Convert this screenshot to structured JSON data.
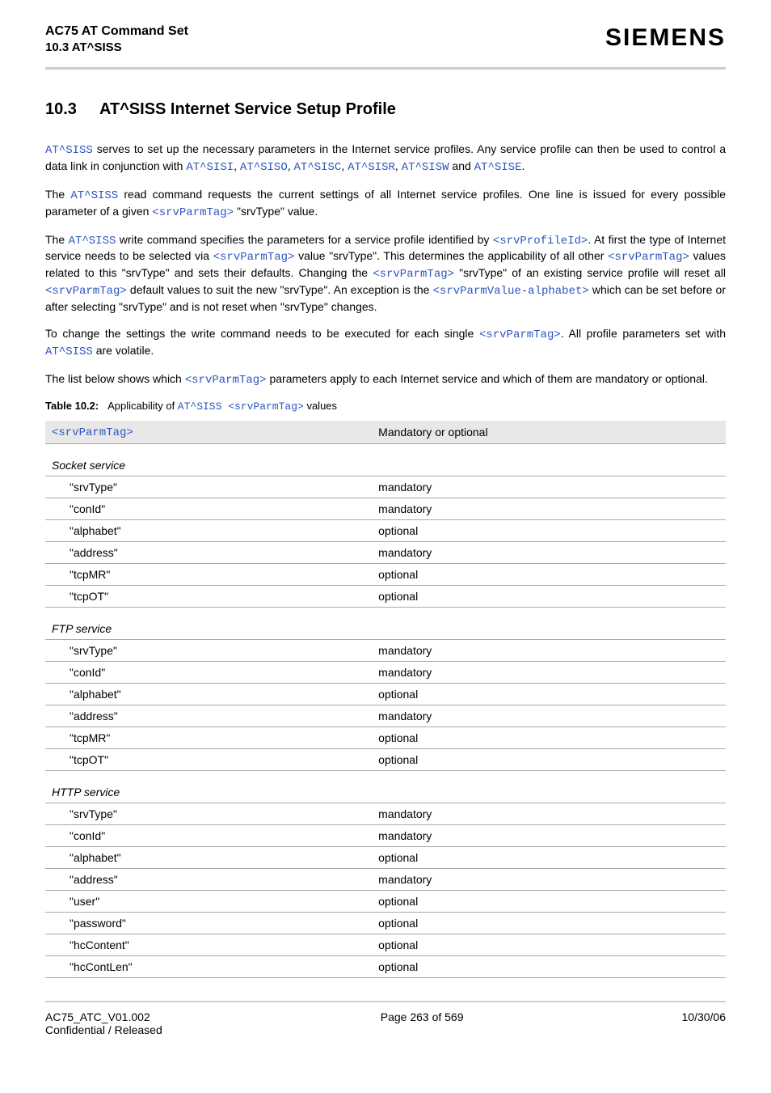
{
  "header": {
    "title": "AC75 AT Command Set",
    "sub": "10.3 AT^SISS",
    "brand": "SIEMENS"
  },
  "section": {
    "num": "10.3",
    "title": "AT^SISS   Internet Service Setup Profile"
  },
  "links": {
    "at_siss": "AT^SISS",
    "at_sisi": "AT^SISI",
    "at_siso": "AT^SISO",
    "at_sisc": "AT^SISC",
    "at_sisr": "AT^SISR",
    "at_sisw": "AT^SISW",
    "at_sise": "AT^SISE",
    "srvParmTag": "<srvParmTag>",
    "srvProfileId": "<srvProfileId>",
    "srvParmValueAlpha": "<srvParmValue-alphabet>"
  },
  "p1a": " serves to set up the necessary parameters in the Internet service profiles. Any service profile can then be used to control a data link in conjunction with ",
  "p1b": ", ",
  "p1c": ", ",
  "p1d": ", ",
  "p1e": ", ",
  "p1f": " and ",
  "p1g": ".",
  "p2a": "The ",
  "p2b": " read command requests the current settings of all Internet service profiles. One line is issued for every possible parameter of a given ",
  "p2c": " \"srvType\" value.",
  "p3a": "The ",
  "p3b": " write command specifies the parameters for a service profile identified by ",
  "p3c": ". At first the type of Internet service needs to be selected via ",
  "p3d": " value \"srvType\". This determines the applicability of all other ",
  "p3e": " values related to this \"srvType\" and sets their defaults. Changing the ",
  "p3f": " \"srvType\" of an existing service profile will reset all ",
  "p3g": " default values to suit the new \"srvType\". An exception is the ",
  "p3h": " which can be set before or after selecting \"srvType\" and is not reset when \"srvType\" changes.",
  "p4a": "To change the settings the write command needs to be executed for each single ",
  "p4b": ". All profile parameters set with ",
  "p4c": " are volatile.",
  "p5a": "The list below shows which ",
  "p5b": " parameters apply to each Internet service and which of them are mandatory or optional.",
  "tableCaption": {
    "label": "Table 10.2:",
    "text1": "Applicability of ",
    "cmd": "AT^SISS ",
    "param": "<srvParmTag>",
    "text2": " values"
  },
  "tableHeaders": {
    "col1": "<srvParmTag>",
    "col2": "Mandatory or optional"
  },
  "services": [
    {
      "name": "Socket service",
      "rows": [
        {
          "tag": "\"srvType\"",
          "opt": "mandatory"
        },
        {
          "tag": "\"conId\"",
          "opt": "mandatory"
        },
        {
          "tag": "\"alphabet\"",
          "opt": "optional"
        },
        {
          "tag": "\"address\"",
          "opt": "mandatory"
        },
        {
          "tag": "\"tcpMR\"",
          "opt": "optional"
        },
        {
          "tag": "\"tcpOT\"",
          "opt": "optional"
        }
      ]
    },
    {
      "name": "FTP service",
      "rows": [
        {
          "tag": "\"srvType\"",
          "opt": "mandatory"
        },
        {
          "tag": "\"conId\"",
          "opt": "mandatory"
        },
        {
          "tag": "\"alphabet\"",
          "opt": "optional"
        },
        {
          "tag": "\"address\"",
          "opt": "mandatory"
        },
        {
          "tag": "\"tcpMR\"",
          "opt": "optional"
        },
        {
          "tag": "\"tcpOT\"",
          "opt": "optional"
        }
      ]
    },
    {
      "name": "HTTP service",
      "rows": [
        {
          "tag": "\"srvType\"",
          "opt": "mandatory"
        },
        {
          "tag": "\"conId\"",
          "opt": "mandatory"
        },
        {
          "tag": "\"alphabet\"",
          "opt": "optional"
        },
        {
          "tag": "\"address\"",
          "opt": "mandatory"
        },
        {
          "tag": "\"user\"",
          "opt": "optional"
        },
        {
          "tag": "\"password\"",
          "opt": "optional"
        },
        {
          "tag": "\"hcContent\"",
          "opt": "optional"
        },
        {
          "tag": "\"hcContLen\"",
          "opt": "optional"
        }
      ]
    }
  ],
  "footer": {
    "left1": "AC75_ATC_V01.002",
    "left2": "Confidential / Released",
    "center": "Page 263 of 569",
    "right": "10/30/06"
  }
}
